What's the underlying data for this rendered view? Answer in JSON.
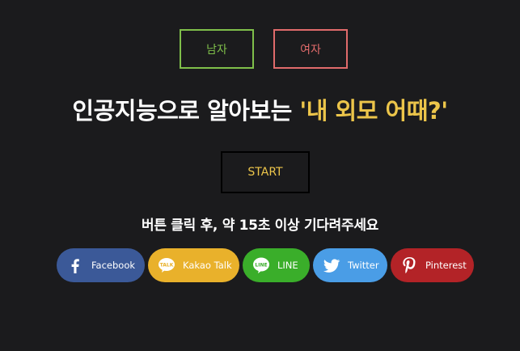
{
  "gender": {
    "male_label": "남자",
    "female_label": "여자",
    "male_color": "#7fbf4a",
    "female_color": "#e06b6b"
  },
  "headline": {
    "main": "인공지능으로 알아보는 ",
    "highlight": "'내 외모 어때?'",
    "highlight_color": "#ecc54a"
  },
  "start": {
    "label": "START",
    "color": "#ecc54a"
  },
  "hint": "버튼 클릭 후, 약 15초 이상 기다려주세요",
  "share": [
    {
      "label": "Facebook",
      "icon": "facebook-icon",
      "color": "#3b5998"
    },
    {
      "label": "Kakao Talk",
      "icon": "kakaotalk-icon",
      "color": "#e9b12b"
    },
    {
      "label": "LINE",
      "icon": "line-icon",
      "color": "#3aae2a"
    },
    {
      "label": "Twitter",
      "icon": "twitter-icon",
      "color": "#4a9de6"
    },
    {
      "label": "Pinterest",
      "icon": "pinterest-icon",
      "color": "#b32327"
    }
  ]
}
